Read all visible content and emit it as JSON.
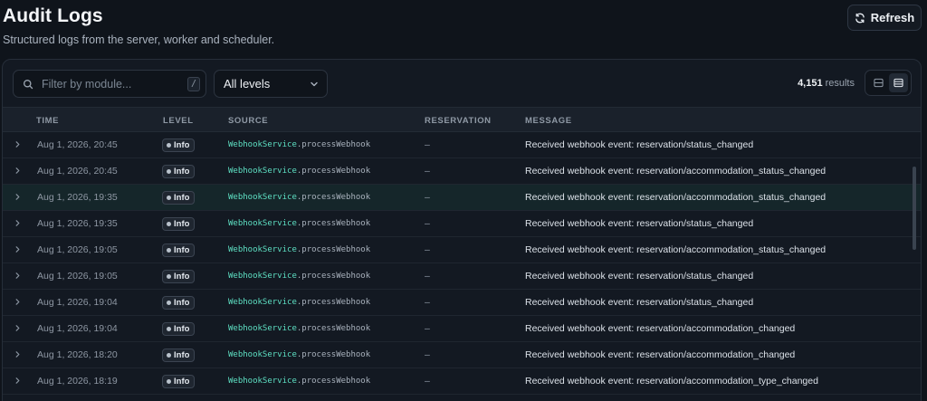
{
  "header": {
    "title": "Audit Logs",
    "subtitle": "Structured logs from the server, worker and scheduler.",
    "refresh_label": "Refresh"
  },
  "toolbar": {
    "search_placeholder": "Filter by module...",
    "search_shortcut": "/",
    "level_selected": "All levels",
    "results_count": "4,151",
    "results_label": "results"
  },
  "table": {
    "columns": [
      "TIME",
      "LEVEL",
      "SOURCE",
      "RESERVATION",
      "MESSAGE"
    ],
    "rows": [
      {
        "time": "Aug 1, 2026, 20:45",
        "level": "Info",
        "source_class": "WebhookService",
        "source_method": ".processWebhook",
        "reservation": "–",
        "message": "Received webhook event: reservation/status_changed"
      },
      {
        "time": "Aug 1, 2026, 20:45",
        "level": "Info",
        "source_class": "WebhookService",
        "source_method": ".processWebhook",
        "reservation": "–",
        "message": "Received webhook event: reservation/accommodation_status_changed"
      },
      {
        "time": "Aug 1, 2026, 19:35",
        "level": "Info",
        "source_class": "WebhookService",
        "source_method": ".processWebhook",
        "reservation": "–",
        "message": "Received webhook event: reservation/accommodation_status_changed"
      },
      {
        "time": "Aug 1, 2026, 19:35",
        "level": "Info",
        "source_class": "WebhookService",
        "source_method": ".processWebhook",
        "reservation": "–",
        "message": "Received webhook event: reservation/status_changed"
      },
      {
        "time": "Aug 1, 2026, 19:05",
        "level": "Info",
        "source_class": "WebhookService",
        "source_method": ".processWebhook",
        "reservation": "–",
        "message": "Received webhook event: reservation/accommodation_status_changed"
      },
      {
        "time": "Aug 1, 2026, 19:05",
        "level": "Info",
        "source_class": "WebhookService",
        "source_method": ".processWebhook",
        "reservation": "–",
        "message": "Received webhook event: reservation/status_changed"
      },
      {
        "time": "Aug 1, 2026, 19:04",
        "level": "Info",
        "source_class": "WebhookService",
        "source_method": ".processWebhook",
        "reservation": "–",
        "message": "Received webhook event: reservation/status_changed"
      },
      {
        "time": "Aug 1, 2026, 19:04",
        "level": "Info",
        "source_class": "WebhookService",
        "source_method": ".processWebhook",
        "reservation": "–",
        "message": "Received webhook event: reservation/accommodation_changed"
      },
      {
        "time": "Aug 1, 2026, 18:20",
        "level": "Info",
        "source_class": "WebhookService",
        "source_method": ".processWebhook",
        "reservation": "–",
        "message": "Received webhook event: reservation/accommodation_changed"
      },
      {
        "time": "Aug 1, 2026, 18:19",
        "level": "Info",
        "source_class": "WebhookService",
        "source_method": ".processWebhook",
        "reservation": "–",
        "message": "Received webhook event: reservation/accommodation_type_changed"
      }
    ]
  },
  "colors": {
    "background": "#0f141b",
    "panel": "#131922",
    "source_accent": "#5ee0c3",
    "highlight_row": "#15262a"
  },
  "icons": {
    "refresh": "refresh-icon",
    "search": "search-icon",
    "chevron_down": "chevron-down-icon",
    "row_expand": "chevron-right-icon",
    "view_compact": "compact-view-icon",
    "view_comfortable": "comfortable-view-icon"
  }
}
